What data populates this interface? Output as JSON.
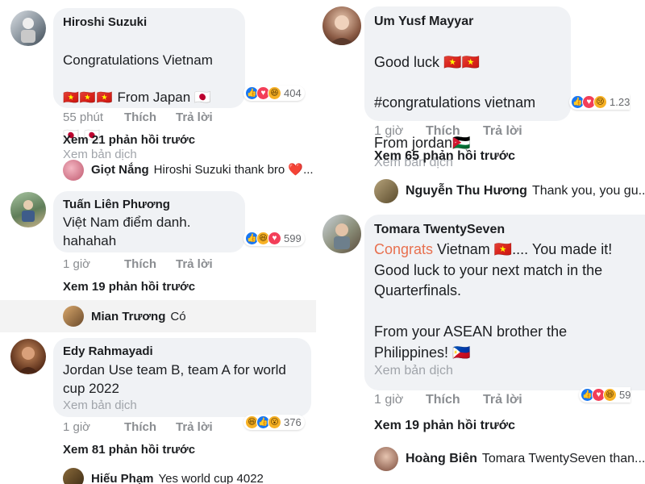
{
  "left": {
    "comments": [
      {
        "name": "Hiroshi Suzuki",
        "body": "Congratulations Vietnam",
        "flags1": "🇻🇳🇻🇳🇻🇳",
        "flags1_tail": " From Japan 🇯🇵",
        "flags2": "🇯🇵 🇯🇵",
        "translate": "Xem bản dịch",
        "reactions": [
          "like",
          "love",
          "haha"
        ],
        "count": "404",
        "time": "55 phút",
        "like": "Thích",
        "reply": "Trả lời",
        "more": "Xem 21 phản hồi trước",
        "reply_name": "Giọt Nắng",
        "reply_text": "Hiroshi Suzuki thank bro ❤️..."
      },
      {
        "name": "Tuấn Liên Phương",
        "body": "Việt Nam điểm danh.\nhahahah",
        "reactions": [
          "like",
          "haha",
          "love"
        ],
        "count": "599",
        "time": "1 giờ",
        "like": "Thích",
        "reply": "Trả lời",
        "more": "Xem 19 phản hồi trước",
        "reply_name": "Mian Trương",
        "reply_text": "Có"
      },
      {
        "name": "Edy Rahmayadi",
        "body": "Jordan Use team B, team A for world\ncup 2022",
        "translate": "Xem bản dịch",
        "reactions": [
          "haha",
          "like",
          "wow"
        ],
        "count": "376",
        "time": "1 giờ",
        "like": "Thích",
        "reply": "Trả lời",
        "more": "Xem 81 phản hồi trước",
        "reply_name": "Hiếu Phạm",
        "reply_text": "Yes world cup 4022"
      }
    ]
  },
  "right": {
    "comments": [
      {
        "name": "Um Yusf Mayyar",
        "line1": "Good luck 🇻🇳🇻🇳",
        "line2": "#congratulations vietnam",
        "line3": "From  jordan🇯🇴",
        "translate": "Xem bản dịch",
        "reactions": [
          "like",
          "love",
          "sad"
        ],
        "count": "1.23",
        "time": "1 giờ",
        "like": "Thích",
        "reply": "Trả lời",
        "more": "Xem 65 phản hồi trước",
        "reply_name": "Nguyễn Thu Hương",
        "reply_text": "Thank you, you gu..."
      },
      {
        "name": "Tomara TwentySeven",
        "congrats": "Congrats",
        "line1_tail": " Vietnam 🇻🇳.... You made it!",
        "line2": "Good luck to your next match in the",
        "line3": "Quarterfinals.",
        "line4": "From your ASEAN brother the",
        "line5": "Philippines! 🇵🇭",
        "translate": "Xem bản dịch",
        "reactions": [
          "like",
          "love",
          "haha"
        ],
        "count": "59",
        "time": "1 giờ",
        "like": "Thích",
        "reply": "Trả lời",
        "more": "Xem 19 phản hồi trước",
        "reply_name": "Hoàng Biên",
        "reply_text": "Tomara TwentySeven than..."
      }
    ]
  }
}
